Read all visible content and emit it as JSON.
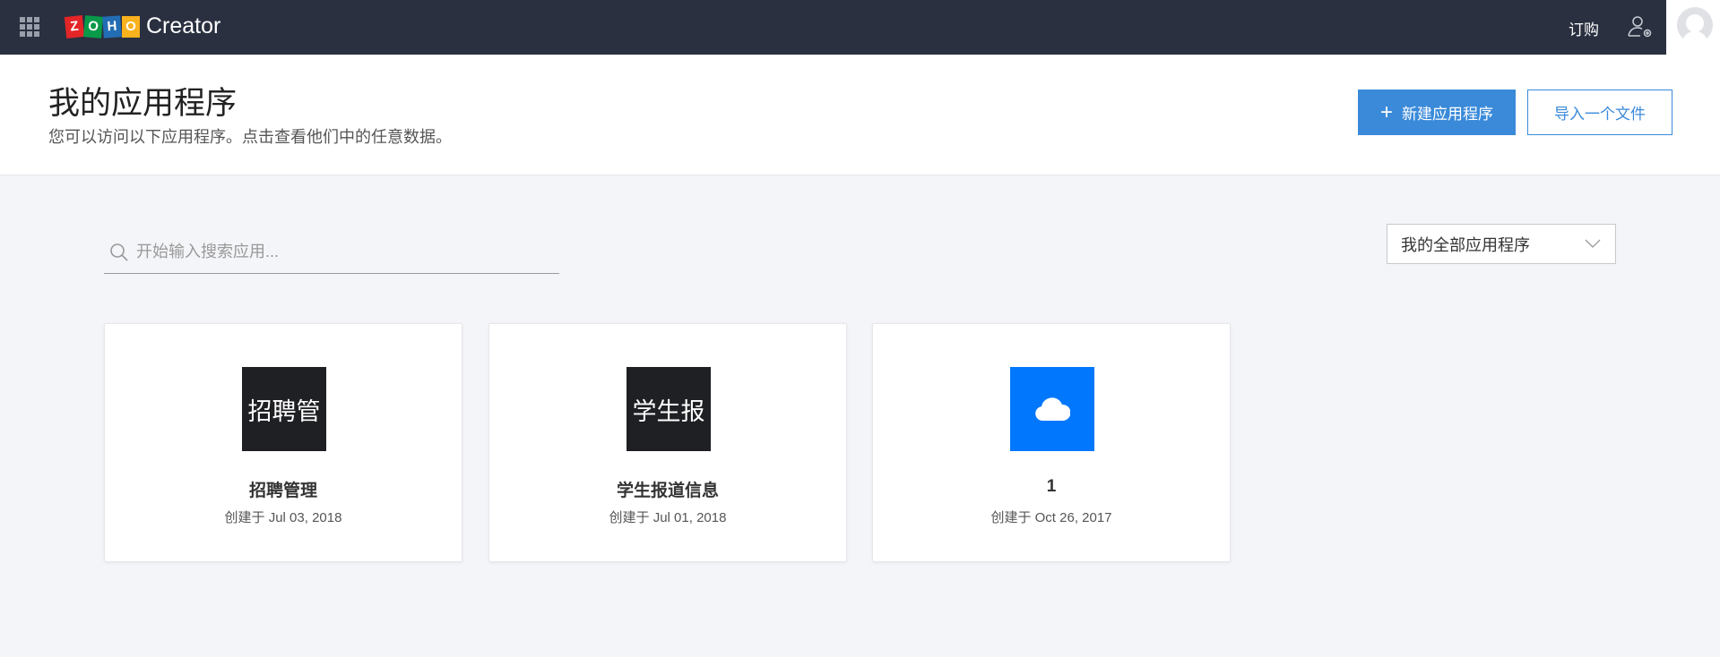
{
  "header": {
    "brand_letters": [
      "Z",
      "O",
      "H",
      "O"
    ],
    "brand_colors": [
      "#e42527",
      "#089949",
      "#226db4",
      "#f9b21d"
    ],
    "product": "Creator",
    "order_label": "订购"
  },
  "page": {
    "title": "我的应用程序",
    "subtitle": "您可以访问以下应用程序。点击查看他们中的任意数据。",
    "new_app_label": "新建应用程序",
    "import_label": "导入一个文件"
  },
  "search": {
    "placeholder": "开始输入搜索应用..."
  },
  "filter": {
    "selected": "我的全部应用程序"
  },
  "apps": [
    {
      "icon_text": "招聘管",
      "name": "招聘管理",
      "created": "创建于 Jul 03, 2018",
      "color": "#1f2024"
    },
    {
      "icon_text": "学生报",
      "name": "学生报道信息",
      "created": "创建于 Jul 01, 2018",
      "color": "#1f2024"
    },
    {
      "icon": "cloud-icon",
      "name": "1",
      "created": "创建于 Oct 26, 2017",
      "color": "#0177fe"
    }
  ]
}
